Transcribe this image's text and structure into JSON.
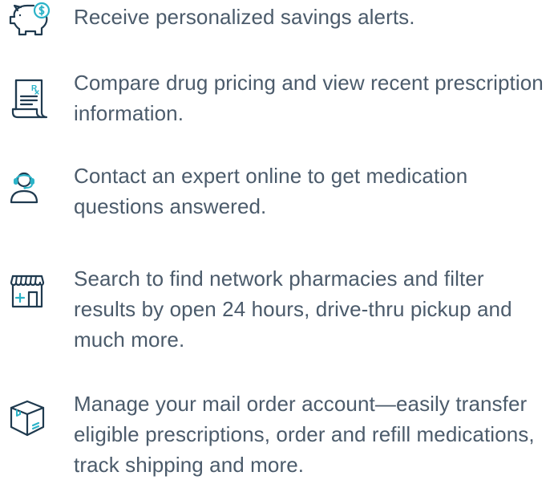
{
  "colors": {
    "icon_outline": "#1f3a4f",
    "icon_accent": "#2bb3c8",
    "text": "#4b5b6b",
    "background": "#ffffff"
  },
  "features": [
    {
      "icon": "piggy-bank-dollar-icon",
      "text": "Receive personalized savings alerts."
    },
    {
      "icon": "prescription-receipt-icon",
      "text": "Compare drug pricing and view recent prescription information."
    },
    {
      "icon": "headset-expert-icon",
      "text": "Contact an expert online to get medication questions answered."
    },
    {
      "icon": "pharmacy-storefront-icon",
      "text": "Search to find network pharmacies and filter results by open 24 hours, drive-thru pickup and much more."
    },
    {
      "icon": "package-box-icon",
      "text": "Manage your mail order account—easily transfer eligible prescriptions, order and refill medications, track shipping and more."
    }
  ]
}
